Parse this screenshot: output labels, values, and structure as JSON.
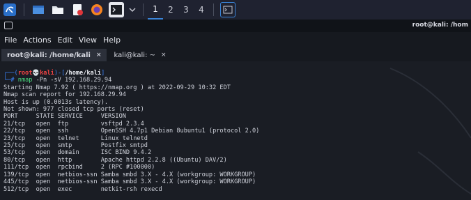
{
  "taskbar": {
    "workspaces": [
      "1",
      "2",
      "3",
      "4"
    ],
    "active_workspace": "1"
  },
  "window": {
    "title": "root@kali: /hom"
  },
  "menu": [
    "File",
    "Actions",
    "Edit",
    "View",
    "Help"
  ],
  "tabs": [
    {
      "label": "root@kali: /home/kali",
      "active": true
    },
    {
      "label": "kali@kali: ~",
      "active": false
    }
  ],
  "tab_close_glyph": "×",
  "prompt": {
    "open": "┌──(",
    "user": "root",
    "skull": "💀",
    "host": "kali",
    "mid": ")-[",
    "path": "/home/kali",
    "close": "]",
    "line2_prefix": "└─",
    "hash": "#",
    "cmd_name": "nmap",
    "cmd_args": " -Pn -sV 192.168.29.94"
  },
  "output": [
    "Starting Nmap 7.92 ( https://nmap.org ) at 2022-09-29 10:32 EDT",
    "Nmap scan report for 192.168.29.94",
    "Host is up (0.0013s latency).",
    "Not shown: 977 closed tcp ports (reset)",
    "PORT     STATE SERVICE     VERSION",
    "21/tcp   open  ftp         vsftpd 2.3.4",
    "22/tcp   open  ssh         OpenSSH 4.7p1 Debian 8ubuntu1 (protocol 2.0)",
    "23/tcp   open  telnet      Linux telnetd",
    "25/tcp   open  smtp        Postfix smtpd",
    "53/tcp   open  domain      ISC BIND 9.4.2",
    "80/tcp   open  http        Apache httpd 2.2.8 ((Ubuntu) DAV/2)",
    "111/tcp  open  rpcbind     2 (RPC #100000)",
    "139/tcp  open  netbios-ssn Samba smbd 3.X - 4.X (workgroup: WORKGROUP)",
    "445/tcp  open  netbios-ssn Samba smbd 3.X - 4.X (workgroup: WORKGROUP)",
    "512/tcp  open  exec        netkit-rsh rexecd"
  ]
}
